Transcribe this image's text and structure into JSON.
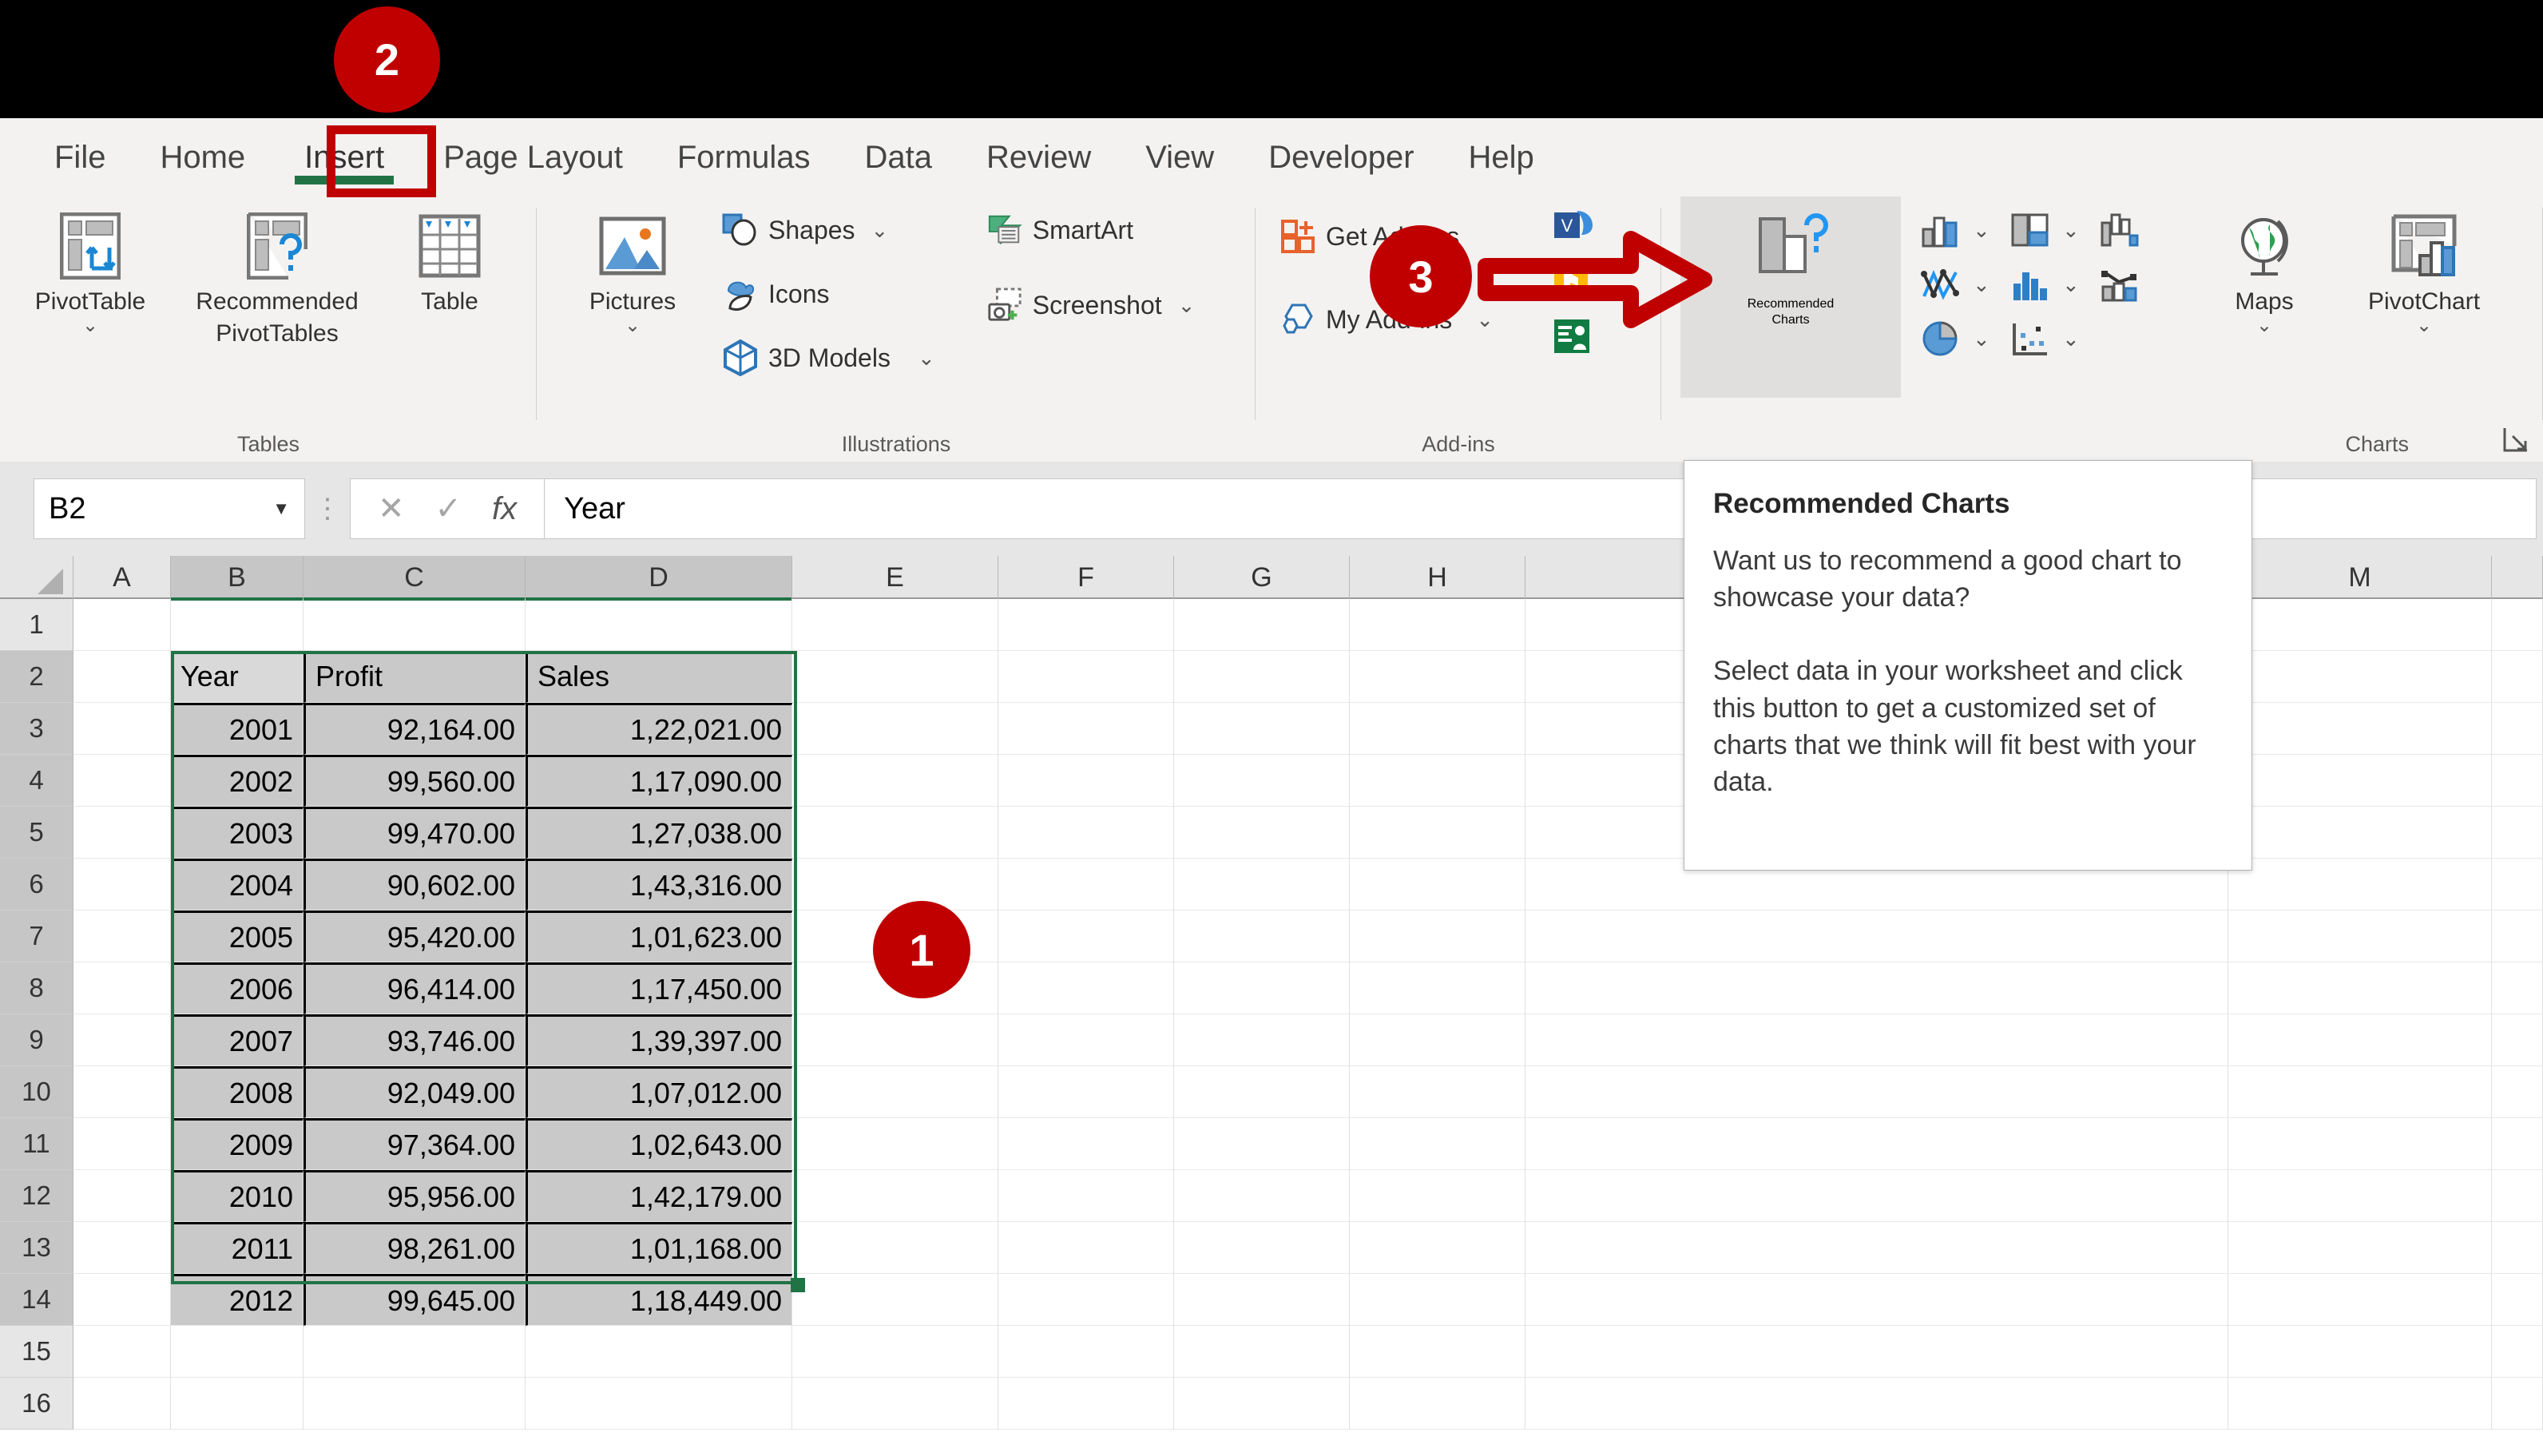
{
  "ribbon": {
    "tabs": [
      {
        "label": "File",
        "active": false
      },
      {
        "label": "Home",
        "active": false
      },
      {
        "label": "Insert",
        "active": true
      },
      {
        "label": "Page Layout",
        "active": false
      },
      {
        "label": "Formulas",
        "active": false
      },
      {
        "label": "Data",
        "active": false
      },
      {
        "label": "Review",
        "active": false
      },
      {
        "label": "View",
        "active": false
      },
      {
        "label": "Developer",
        "active": false
      },
      {
        "label": "Help",
        "active": false
      }
    ],
    "groups": {
      "tables": {
        "label": "Tables",
        "pivottable": "PivotTable",
        "recommended_pivottables_l1": "Recommended",
        "recommended_pivottables_l2": "PivotTables",
        "table": "Table"
      },
      "illustrations": {
        "label": "Illustrations",
        "pictures": "Pictures",
        "shapes": "Shapes",
        "icons": "Icons",
        "models3d": "3D Models",
        "smartart": "SmartArt",
        "screenshot": "Screenshot"
      },
      "addins": {
        "label": "Add-ins",
        "get_addins": "Get Add-ins",
        "my_addins": "My Add-ins"
      },
      "charts": {
        "label": "Charts",
        "recommended_charts_l1": "Recommended",
        "recommended_charts_l2": "Charts",
        "maps": "Maps",
        "pivotchart": "PivotChart",
        "mini": [
          "column-bar-chart-icon",
          "hierarchy-chart-icon",
          "waterfall-chart-icon",
          "line-chart-icon",
          "statistic-chart-icon",
          "combo-chart-icon",
          "pie-chart-icon",
          "scatter-chart-icon"
        ]
      }
    }
  },
  "formula_bar": {
    "name_box_value": "B2",
    "cancel_icon": "✕",
    "enter_icon": "✓",
    "function_icon": "fx",
    "formula_value": "Year"
  },
  "grid": {
    "columns": [
      "A",
      "B",
      "C",
      "D",
      "E",
      "F",
      "G",
      "H",
      "",
      "M"
    ],
    "selected_columns": [
      "B",
      "C",
      "D"
    ],
    "row_numbers": [
      1,
      2,
      3,
      4,
      5,
      6,
      7,
      8,
      9,
      10,
      11,
      12,
      13,
      14,
      15,
      16
    ],
    "selected_rows": [
      2,
      3,
      4,
      5,
      6,
      7,
      8,
      9,
      10,
      11,
      12,
      13,
      14
    ],
    "active_cell": "B2",
    "selection_range": "B2:D14"
  },
  "chart_data": {
    "type": "table",
    "title": "Year / Profit / Sales",
    "headers": [
      "Year",
      "Profit",
      "Sales"
    ],
    "categories": [
      2001,
      2002,
      2003,
      2004,
      2005,
      2006,
      2007,
      2008,
      2009,
      2010,
      2011,
      2012
    ],
    "series": [
      {
        "name": "Profit",
        "values": [
          92164,
          99560,
          99470,
          90602,
          95420,
          96414,
          93746,
          92049,
          97364,
          95956,
          98261,
          99645
        ]
      },
      {
        "name": "Sales",
        "values": [
          122021,
          117090,
          127038,
          143316,
          101623,
          117450,
          139397,
          107012,
          102643,
          142179,
          101168,
          118449
        ]
      }
    ],
    "rows": [
      [
        "2001",
        "92,164.00",
        "1,22,021.00"
      ],
      [
        "2002",
        "99,560.00",
        "1,17,090.00"
      ],
      [
        "2003",
        "99,470.00",
        "1,27,038.00"
      ],
      [
        "2004",
        "90,602.00",
        "1,43,316.00"
      ],
      [
        "2005",
        "95,420.00",
        "1,01,623.00"
      ],
      [
        "2006",
        "96,414.00",
        "1,17,450.00"
      ],
      [
        "2007",
        "93,746.00",
        "1,39,397.00"
      ],
      [
        "2008",
        "92,049.00",
        "1,07,012.00"
      ],
      [
        "2009",
        "97,364.00",
        "1,02,643.00"
      ],
      [
        "2010",
        "95,956.00",
        "1,42,179.00"
      ],
      [
        "2011",
        "98,261.00",
        "1,01,168.00"
      ],
      [
        "2012",
        "99,645.00",
        "1,18,449.00"
      ]
    ]
  },
  "tooltip": {
    "title": "Recommended Charts",
    "paragraph1": "Want us to recommend a good chart to showcase your data?",
    "paragraph2": "Select data in your worksheet and click this button to get a customized set of charts that we think will fit best with your data."
  },
  "annotations": {
    "badge1": "1",
    "badge2": "2",
    "badge3": "3",
    "accent_color": "#c00000",
    "excel_green": "#217346"
  }
}
